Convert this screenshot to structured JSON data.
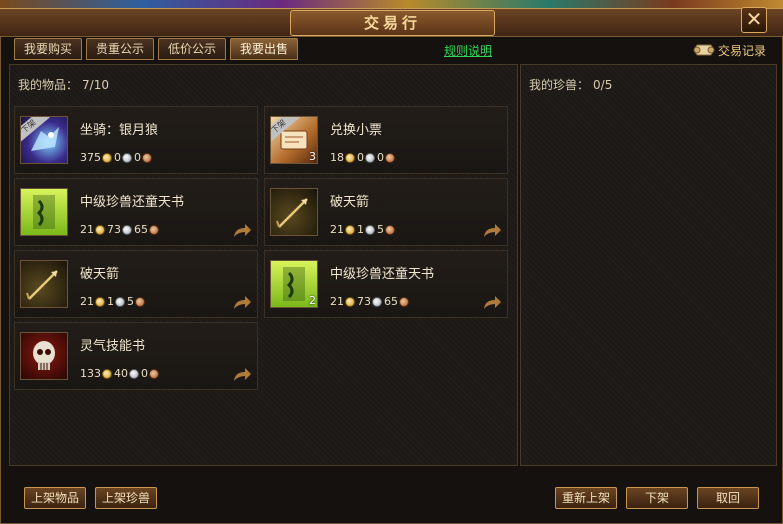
{
  "window": {
    "title": "交易行",
    "close_label": "✕"
  },
  "tabs": [
    {
      "label": "我要购买"
    },
    {
      "label": "贵重公示"
    },
    {
      "label": "低价公示"
    },
    {
      "label": "我要出售",
      "active": true
    }
  ],
  "rules_link": "规则说明",
  "records_link": "交易记录",
  "left_panel": {
    "label": "我的物品：",
    "count": "7/10"
  },
  "right_panel": {
    "label": "我的珍兽：",
    "count": "0/5"
  },
  "items": [
    {
      "name": "坐骑：银月狼",
      "gold": "375",
      "silver": "0",
      "copper": "0",
      "qty": "",
      "icon": "silver-moon-wolf-mount-icon",
      "tag": "下架",
      "shareable": false
    },
    {
      "name": "兑换小票",
      "gold": "18",
      "silver": "0",
      "copper": "0",
      "qty": "3",
      "icon": "exchange-ticket-icon",
      "tag": "下架",
      "shareable": false
    },
    {
      "name": "中级珍兽还童天书",
      "gold": "21",
      "silver": "73",
      "copper": "65",
      "qty": "",
      "icon": "green-scroll-icon",
      "tag": "",
      "shareable": true
    },
    {
      "name": "破天箭",
      "gold": "21",
      "silver": "1",
      "copper": "5",
      "qty": "",
      "icon": "arrow-icon",
      "tag": "",
      "shareable": true
    },
    {
      "name": "破天箭",
      "gold": "21",
      "silver": "1",
      "copper": "5",
      "qty": "",
      "icon": "arrow-icon",
      "tag": "",
      "shareable": true
    },
    {
      "name": "中级珍兽还童天书",
      "gold": "21",
      "silver": "73",
      "copper": "65",
      "qty": "2",
      "icon": "green-scroll-icon",
      "tag": "",
      "shareable": true
    },
    {
      "name": "灵气技能书",
      "gold": "133",
      "silver": "40",
      "copper": "0",
      "qty": "",
      "icon": "skull-skill-book-icon",
      "tag": "",
      "shareable": true
    }
  ],
  "buttons": {
    "list_item": "上架物品",
    "list_pet": "上架珍兽",
    "relist": "重新上架",
    "delist": "下架",
    "cancel": "取回"
  }
}
